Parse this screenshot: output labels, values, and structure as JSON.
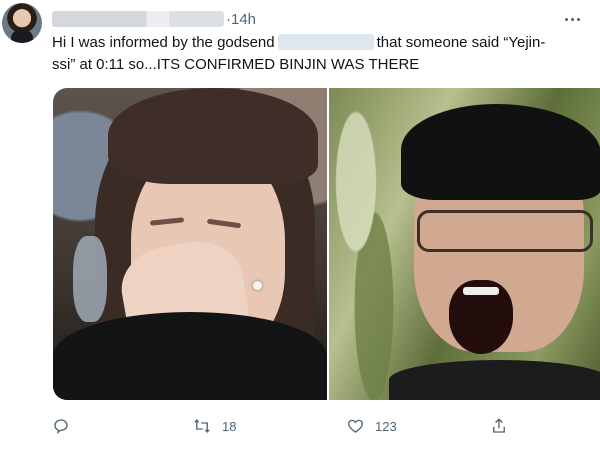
{
  "tweet": {
    "time": "·14h",
    "text_line1_a": "Hi I was informed by the godsend",
    "text_line1_b": "that  someone said “Yejin-",
    "text_line2": "ssi” at 0:11 so...ITS CONFIRMED BINJIN WAS THERE"
  },
  "actions": {
    "retweet_count": "18",
    "like_count": "123"
  },
  "icons": {
    "more": "more-horizontal-icon",
    "reply": "reply-icon",
    "retweet": "retweet-icon",
    "like": "heart-icon",
    "share": "share-icon"
  },
  "colors": {
    "text": "#0f1419",
    "secondary": "#536471"
  }
}
